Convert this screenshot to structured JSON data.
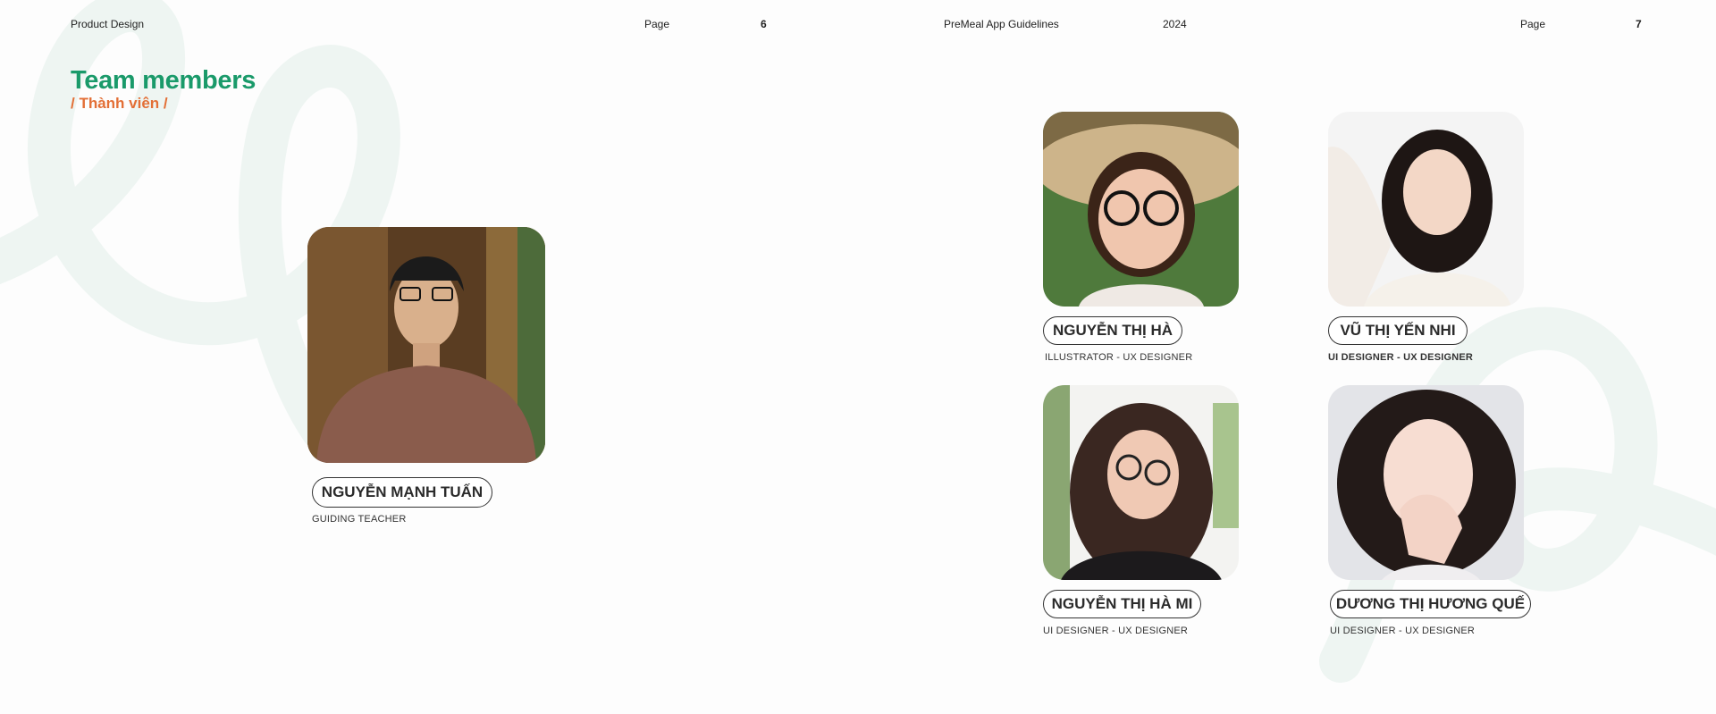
{
  "header": {
    "left_title": "Product Design",
    "page_label_left": "Page",
    "page_num_left": "6",
    "doc_title": "PreMeal App Guidelines",
    "year": "2024",
    "page_label_right": "Page",
    "page_num_right": "7"
  },
  "section": {
    "title_en": "Team members",
    "title_vi": "/ Thành viên /"
  },
  "teacher": {
    "name": "NGUYỄN MẠNH TUẤN",
    "role": "GUIDING TEACHER"
  },
  "members": [
    {
      "name": "NGUYỄN THỊ HÀ",
      "role": "ILLUSTRATOR - UX DESIGNER"
    },
    {
      "name": "VŨ THỊ YẾN NHI",
      "role": "UI DESIGNER - UX DESIGNER"
    },
    {
      "name": "NGUYỄN THỊ HÀ MI",
      "role": "UI DESIGNER - UX DESIGNER"
    },
    {
      "name": "DƯƠNG THỊ HƯƠNG QUẾ",
      "role": "UI DESIGNER - UX DESIGNER"
    }
  ],
  "colors": {
    "accent_green": "#1a9a6a",
    "accent_orange": "#e36f36",
    "swirl": "#eef5f2"
  }
}
